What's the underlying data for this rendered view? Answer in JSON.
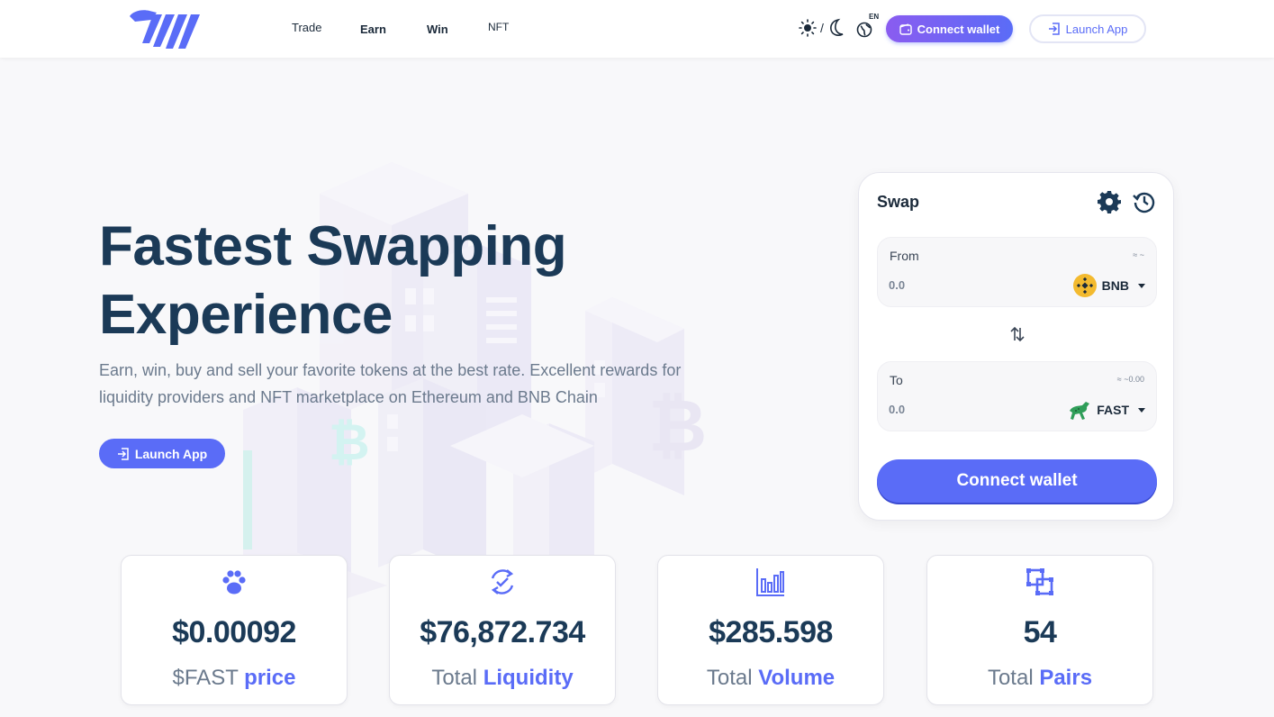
{
  "header": {
    "nav": [
      "Trade",
      "Earn",
      "Win",
      "NFT"
    ],
    "theme_separator": "/",
    "language": "EN",
    "connect_wallet": "Connect wallet",
    "launch_app": "Launch App"
  },
  "hero": {
    "title_line1": "Fastest Swapping",
    "title_line2": "Experience",
    "subtitle": "Earn, win, buy and sell your favorite tokens at the best rate. Excellent rewards for liquidity providers and NFT marketplace on Ethereum and BNB Chain",
    "launch_app": "Launch App"
  },
  "swap": {
    "title": "Swap",
    "from": {
      "label": "From",
      "balance": "≈ ~",
      "amount": "0.0",
      "token": "BNB"
    },
    "to": {
      "label": "To",
      "balance": "≈ ~0.00",
      "amount": "0.0",
      "token": "FAST"
    },
    "connect_wallet": "Connect wallet"
  },
  "stats": [
    {
      "value": "$0.00092",
      "caption_plain": "$FAST",
      "caption_accent": "price",
      "icon": "paw-icon"
    },
    {
      "value": "$76,872.734",
      "caption_plain": "Total",
      "caption_accent": "Liquidity",
      "icon": "refresh-check-icon"
    },
    {
      "value": "$285.598",
      "caption_plain": "Total",
      "caption_accent": "Volume",
      "icon": "bar-chart-icon"
    },
    {
      "value": "54",
      "caption_plain": "Total",
      "caption_accent": "Pairs",
      "icon": "pairs-icon"
    }
  ],
  "colors": {
    "accent": "#5a6cf7",
    "heading": "#1b3a57",
    "muted": "#6b7a8d",
    "bnb": "#f3ba2f"
  }
}
